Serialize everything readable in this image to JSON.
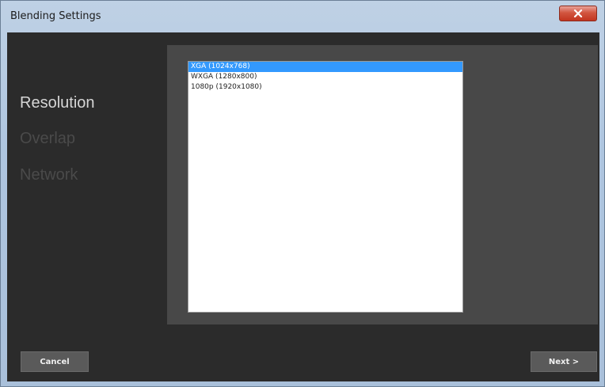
{
  "window": {
    "title": "Blending Settings",
    "close_label": "X"
  },
  "nav": {
    "items": [
      {
        "label": "Resolution",
        "active": true
      },
      {
        "label": "Overlap",
        "active": false
      },
      {
        "label": "Network",
        "active": false
      }
    ]
  },
  "resolution_list": {
    "items": [
      {
        "label": "XGA (1024x768)",
        "selected": true
      },
      {
        "label": "WXGA (1280x800)",
        "selected": false
      },
      {
        "label": "1080p (1920x1080)",
        "selected": false
      }
    ]
  },
  "buttons": {
    "cancel": "Cancel",
    "next": "Next >"
  },
  "colors": {
    "selection": "#3399ff",
    "background": "#2b2b2b",
    "panel": "#484848"
  }
}
